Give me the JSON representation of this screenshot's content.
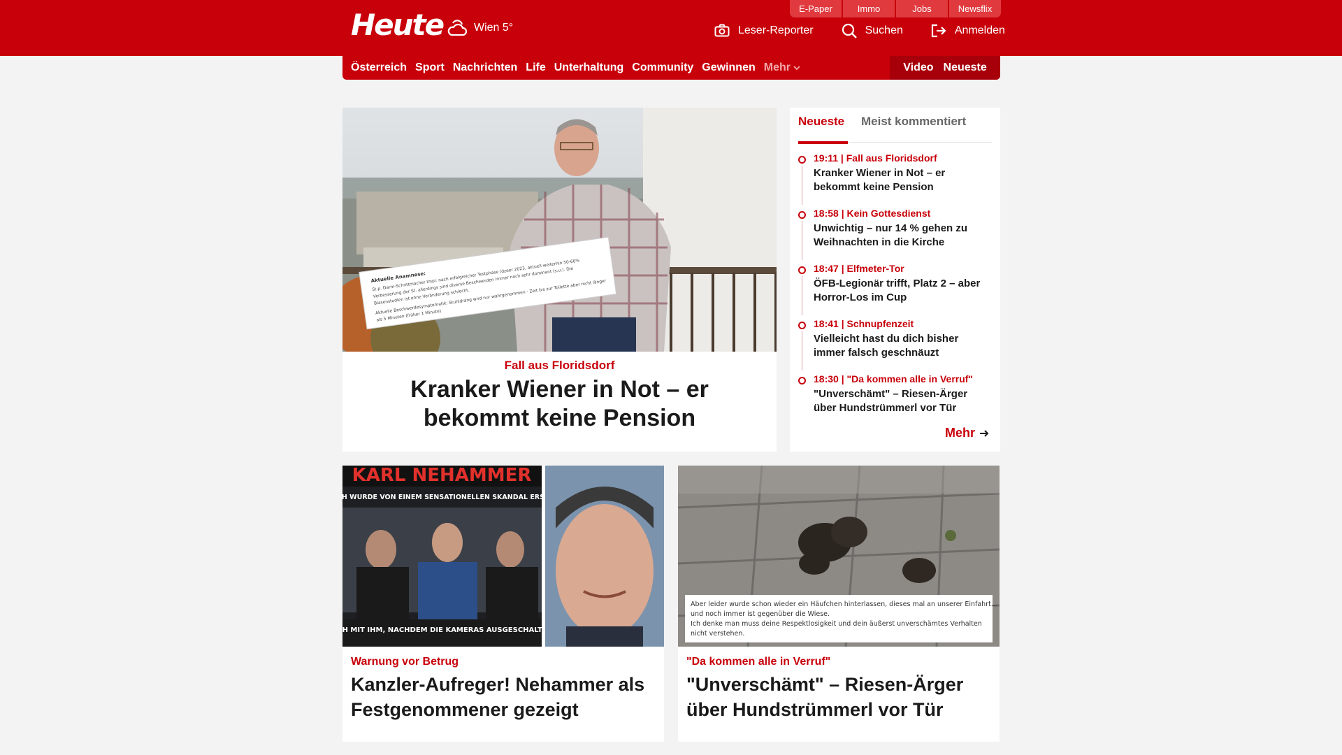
{
  "brand": {
    "logo": "Heute",
    "weather": "Wien 5°",
    "colors": {
      "primary": "#c8000a",
      "tab": "#e03a3f",
      "dark": "#a8000a"
    }
  },
  "service_tabs": [
    "E-Paper",
    "Immo",
    "Jobs",
    "Newsflix"
  ],
  "top_actions": {
    "reporter": "Leser-Reporter",
    "search": "Suchen",
    "login": "Anmelden"
  },
  "nav": {
    "items": [
      "Österreich",
      "Sport",
      "Nachrichten",
      "Life",
      "Unterhaltung",
      "Community",
      "Gewinnen"
    ],
    "more": "Mehr",
    "video": "Video",
    "latest": "Neueste"
  },
  "hero": {
    "kicker": "Fall aus Floridsdorf",
    "title": "Kranker Wiener in Not – er bekommt keine Pension",
    "image_caption": "Aktuelle Anamnese:",
    "image_text": [
      "St.p. Darm-Schrittmacher Impl. nach erfolgreicher Testphase (dzeer 2023, aktuell weiterhin 50-60%",
      "Verbesserung der St. allerdings sind diverse Beschwerden immer noch sehr dominant (s.u.). Die",
      "Blasenstudien ist ohne Veränderung schlecht.",
      "Aktuelle Beschwerdesymptomatik: Stuhldrang wird nur wahrgenommen - Zeit bis zur Toilette aber nicht länger",
      "als 5 Minuten (früher 1 Minute)"
    ]
  },
  "sidebar": {
    "tabs": [
      "Neueste",
      "Meist kommentiert"
    ],
    "items": [
      {
        "meta": "19:11 | Fall aus Floridsdorf",
        "title": "Kranker Wiener in Not – er bekommt keine Pension"
      },
      {
        "meta": "18:58 | Kein Gottesdienst",
        "title": "Unwichtig – nur 14 % gehen zu Weihnachten in die Kirche"
      },
      {
        "meta": "18:47 | Elfmeter-Tor",
        "title": "ÖFB-Legionär trifft, Platz 2 – aber Horror-Los im Cup"
      },
      {
        "meta": "18:41 | Schnupfenzeit",
        "title": "Vielleicht hast du dich bisher immer falsch geschnäuzt"
      },
      {
        "meta": "18:30 | \"Da kommen alle in Verruf\"",
        "title": "\"Unverschämt\" – Riesen-Ärger über Hundstrümmerl vor Tür"
      }
    ],
    "more": "Mehr"
  },
  "cards": [
    {
      "kicker": "Warnung vor Betrug",
      "title": "Kanzler-Aufreger! Nehammer als Festgenommener gezeigt",
      "image_headline": "KARL NEHAMMER",
      "image_sub": "ÖSTERREICH WURDE VON EINEM SENSATIONELLEN SKANDAL ERSCHÜTTERT",
      "image_bottom": "WAS GESCHAH MIT IHM, NACHDEM DIE KAMERAS AUSGESCHALTET WURDEN?"
    },
    {
      "kicker": "\"Da kommen alle in Verruf\"",
      "title": "\"Unverschämt\" – Riesen-Ärger über Hundstrümmerl vor Tür",
      "image_note": [
        "Aber leider wurde schon wieder ein Häufchen hinterlassen, dieses mal an unserer Einfahrt...",
        "und noch immer ist gegenüber die Wiese.",
        "Ich denke man muss deine Respektlosigkeit und dein äußerst unverschämtes Verhalten",
        "nicht verstehen."
      ]
    }
  ]
}
